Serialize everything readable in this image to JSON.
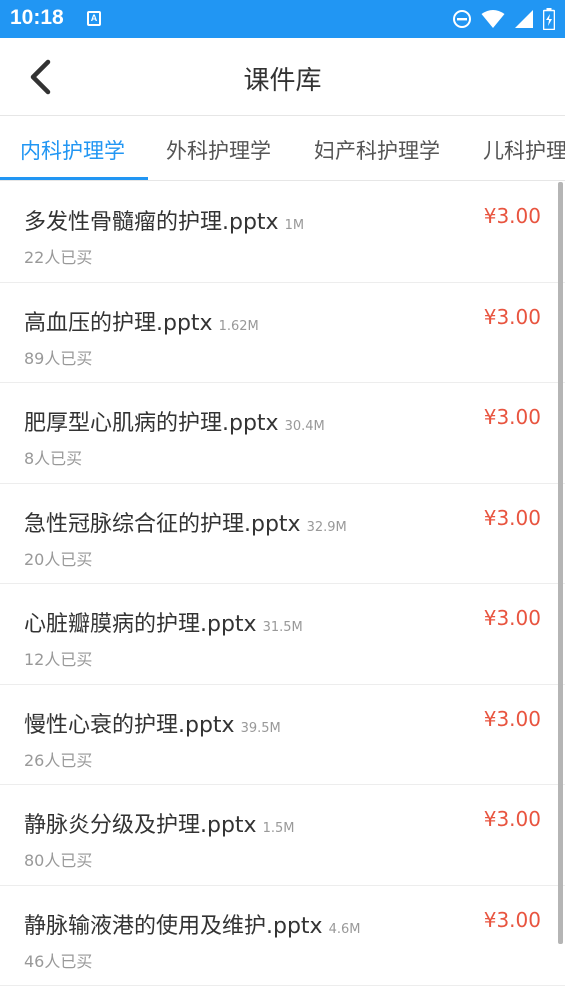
{
  "status_bar": {
    "time": "10:18",
    "notification_icon_letter": "A",
    "icons": [
      "dnd-icon",
      "wifi-icon",
      "signal-icon",
      "battery-icon"
    ]
  },
  "header": {
    "title": "课件库",
    "back_icon": "chevron-left-icon"
  },
  "tabs": [
    {
      "label": "内科护理学",
      "active": true
    },
    {
      "label": "外科护理学",
      "active": false
    },
    {
      "label": "妇产科护理学",
      "active": false
    },
    {
      "label": "儿科护理学",
      "active": false
    }
  ],
  "courseware": [
    {
      "name": "多发性骨髓瘤的护理.pptx",
      "size": "1M",
      "buyers": "22人已买",
      "price": "¥3.00"
    },
    {
      "name": "高血压的护理.pptx",
      "size": "1.62M",
      "buyers": "89人已买",
      "price": "¥3.00"
    },
    {
      "name": "肥厚型心肌病的护理.pptx",
      "size": "30.4M",
      "buyers": "8人已买",
      "price": "¥3.00"
    },
    {
      "name": "急性冠脉综合征的护理.pptx",
      "size": "32.9M",
      "buyers": "20人已买",
      "price": "¥3.00"
    },
    {
      "name": "心脏瓣膜病的护理.pptx",
      "size": "31.5M",
      "buyers": "12人已买",
      "price": "¥3.00"
    },
    {
      "name": "慢性心衰的护理.pptx",
      "size": "39.5M",
      "buyers": "26人已买",
      "price": "¥3.00"
    },
    {
      "name": "静脉炎分级及护理.pptx",
      "size": "1.5M",
      "buyers": "80人已买",
      "price": "¥3.00"
    },
    {
      "name": "静脉输液港的使用及维护.pptx",
      "size": "4.6M",
      "buyers": "46人已买",
      "price": "¥3.00"
    }
  ],
  "colors": {
    "accent": "#2196f3",
    "price": "#e8543f",
    "muted_text": "#999999"
  }
}
